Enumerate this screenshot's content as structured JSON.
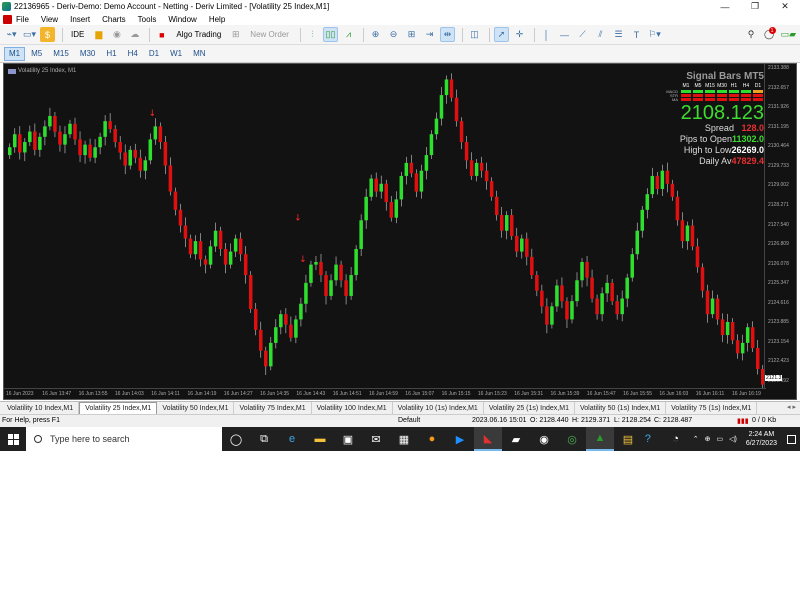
{
  "window": {
    "title": "22136965 - Deriv-Demo: Demo Account - Netting - Deriv Limited - [Volatility 25 Index,M1]",
    "controls": {
      "minimize": "—",
      "restore": "❐",
      "close": "✕"
    }
  },
  "menu": [
    "File",
    "View",
    "Insert",
    "Charts",
    "Tools",
    "Window",
    "Help"
  ],
  "toolbar": {
    "ide_label": "IDE",
    "algo_trading_label": "Algo Trading",
    "new_order_label": "New Order",
    "profile_badge": "1"
  },
  "timeframes": {
    "items": [
      "M1",
      "M5",
      "M15",
      "M30",
      "H1",
      "H4",
      "D1",
      "W1",
      "MN"
    ],
    "active": "M1"
  },
  "chart": {
    "symbol_label": "Volatility 25 Index, M1",
    "y_ticks": [
      "2133.388",
      "2132.657",
      "2131.926",
      "2131.195",
      "2130.464",
      "2129.733",
      "2129.002",
      "2128.271",
      "2127.540",
      "2126.809",
      "2126.078",
      "2125.347",
      "2124.616",
      "2123.885",
      "2123.154",
      "2122.423",
      "2121.692"
    ],
    "current_price_label": "2121.3",
    "x_ticks": [
      "16 Jun 2023",
      "16 Jun 13:47",
      "16 Jun 13:55",
      "16 Jun 14:03",
      "16 Jun 14:11",
      "16 Jun 14:19",
      "16 Jun 14:27",
      "16 Jun 14:35",
      "16 Jun 14:43",
      "16 Jun 14:51",
      "16 Jun 14:59",
      "16 Jun 15:07",
      "16 Jun 15:15",
      "16 Jun 15:23",
      "16 Jun 15:31",
      "16 Jun 15:39",
      "16 Jun 15:47",
      "16 Jun 15:55",
      "16 Jun 16:03",
      "16 Jun 16:11",
      "16 Jun 16:19"
    ],
    "bull_color": "#2ee02e",
    "bear_color": "#e01010",
    "background": "#121212"
  },
  "chart_data": {
    "type": "candlestick",
    "symbol": "Volatility 25 Index",
    "timeframe": "M1",
    "ylim": [
      2121.4,
      2133.4
    ],
    "close_series_approx": [
      2130.4,
      2130.9,
      2130.2,
      2130.6,
      2131.0,
      2130.3,
      2130.8,
      2131.2,
      2131.6,
      2131.0,
      2130.5,
      2130.9,
      2131.3,
      2130.7,
      2130.1,
      2130.5,
      2130.0,
      2130.4,
      2130.8,
      2131.4,
      2131.1,
      2130.6,
      2130.2,
      2129.7,
      2130.3,
      2130.0,
      2129.5,
      2129.9,
      2130.7,
      2131.2,
      2130.6,
      2129.7,
      2128.7,
      2128.0,
      2127.4,
      2126.9,
      2126.3,
      2126.8,
      2126.1,
      2125.9,
      2126.6,
      2127.2,
      2126.5,
      2125.9,
      2126.4,
      2126.9,
      2126.3,
      2125.5,
      2124.2,
      2123.4,
      2122.6,
      2122.0,
      2122.9,
      2123.5,
      2124.0,
      2123.6,
      2123.1,
      2123.8,
      2124.4,
      2125.2,
      2125.9,
      2126.0,
      2125.5,
      2124.7,
      2125.3,
      2125.9,
      2125.3,
      2124.7,
      2125.5,
      2126.5,
      2127.6,
      2128.5,
      2129.2,
      2128.7,
      2129.0,
      2128.3,
      2127.7,
      2128.4,
      2129.3,
      2129.8,
      2129.4,
      2128.7,
      2129.5,
      2130.1,
      2130.9,
      2131.5,
      2132.4,
      2133.0,
      2132.3,
      2131.4,
      2130.6,
      2129.9,
      2129.3,
      2129.8,
      2129.5,
      2129.1,
      2128.5,
      2127.8,
      2127.2,
      2127.8,
      2127.0,
      2126.4,
      2126.9,
      2126.2,
      2125.5,
      2124.9,
      2124.3,
      2123.6,
      2124.3,
      2125.1,
      2124.5,
      2123.8,
      2124.5,
      2125.3,
      2126.0,
      2125.4,
      2124.6,
      2124.0,
      2124.8,
      2125.2,
      2124.5,
      2124.0,
      2124.6,
      2125.4,
      2126.3,
      2127.2,
      2128.0,
      2128.6,
      2129.3,
      2128.8,
      2129.5,
      2129.0,
      2128.5,
      2127.6,
      2126.8,
      2127.4,
      2126.6,
      2125.8,
      2124.9,
      2124.0,
      2124.6,
      2123.8,
      2123.2,
      2123.7,
      2123.0,
      2122.5,
      2122.9,
      2123.5,
      2122.7,
      2121.9,
      2121.3
    ]
  },
  "signal_panel": {
    "title": "Signal Bars MT5",
    "row_labels": [
      "MACD",
      "STR",
      "MA"
    ],
    "timeframes": [
      "M1",
      "M5",
      "M15",
      "M30",
      "H1",
      "H4",
      "D1"
    ],
    "price": "2108.123",
    "spread_label": "Spread",
    "spread_value": "128.0",
    "pips_to_open_label": "Pips to Open",
    "pips_to_open_value": "11302.0",
    "high_to_low_label": "High to Low",
    "high_to_low_value": "26269.0",
    "daily_av_label": "Daily Av",
    "daily_av_value": "47829.4"
  },
  "tabs": {
    "items": [
      "Volatility 10 Index,M1",
      "Volatility 25 Index,M1",
      "Volatility 50 Index,M1",
      "Volatility 75 Index,M1",
      "Volatility 100 Index,M1",
      "Volatility 10 (1s) Index,M1",
      "Volatility 25 (1s) Index,M1",
      "Volatility 50 (1s) Index,M1",
      "Volatility 75 (1s) Index,M1"
    ],
    "active": "Volatility 25 Index,M1"
  },
  "status": {
    "help": "For Help, press F1",
    "profile": "Default",
    "datetime": "2023.06.16 15:01",
    "open": "O: 2128.440",
    "high": "H: 2129.371",
    "low": "L: 2128.254",
    "close": "C: 2128.487",
    "traffic": "0 / 0 Kb"
  },
  "taskbar": {
    "search_placeholder": "Type here to search",
    "time": "2:24 AM",
    "date": "6/27/2023"
  }
}
